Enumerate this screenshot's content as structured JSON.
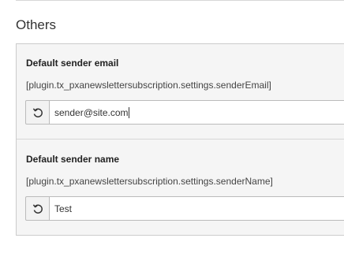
{
  "section": {
    "title": "Others"
  },
  "fields": [
    {
      "label": "Default sender email",
      "path": "[plugin.tx_pxanewslettersubscription.settings.senderEmail]",
      "value": "sender@site.com",
      "reset_icon": "undo-icon"
    },
    {
      "label": "Default sender name",
      "path": "[plugin.tx_pxanewslettersubscription.settings.senderName]",
      "value": "Test",
      "reset_icon": "undo-icon"
    }
  ]
}
